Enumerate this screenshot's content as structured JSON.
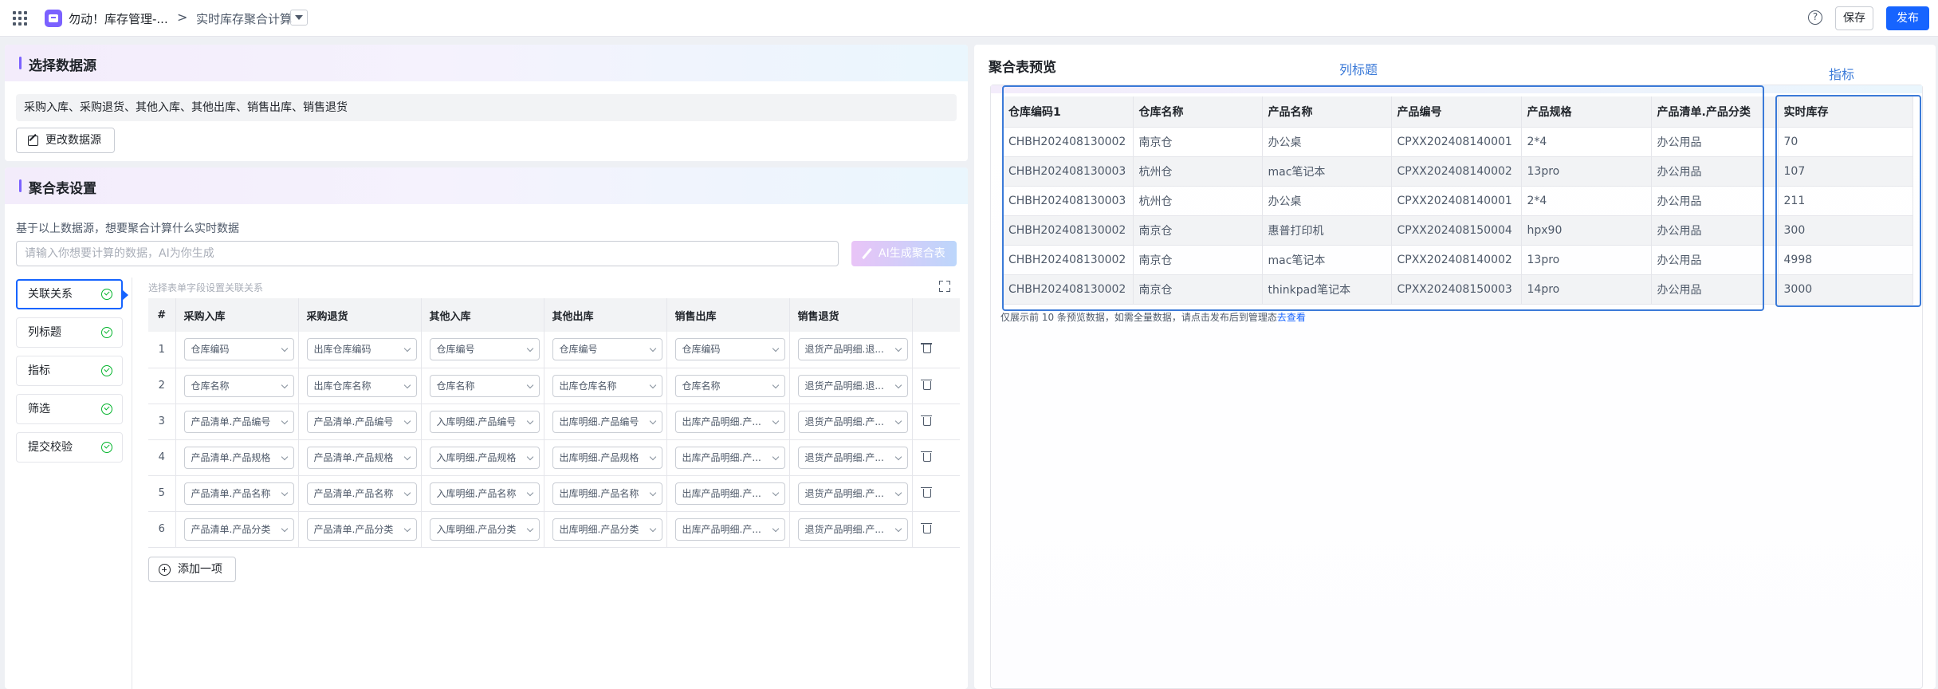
{
  "topbar": {
    "app_name": "勿动！库存管理-...",
    "breadcrumb_sep": ">",
    "page_name": "实时库存聚合计算",
    "help": "?",
    "save_label": "保存",
    "publish_label": "发布"
  },
  "datasource": {
    "title": "选择数据源",
    "value": "采购入库、采购退货、其他入库、其他出库、销售出库、销售退货",
    "change_label": "更改数据源"
  },
  "aggregation": {
    "title": "聚合表设置",
    "prompt_label": "基于以上数据源，想要聚合计算什么实时数据",
    "prompt_placeholder": "请输入你想要计算的数据，AI为你生成",
    "ai_button": "AI生成聚合表",
    "steps": [
      {
        "label": "关联关系"
      },
      {
        "label": "列标题"
      },
      {
        "label": "指标"
      },
      {
        "label": "筛选"
      },
      {
        "label": "提交校验"
      }
    ],
    "table_hint": "选择表单字段设置关联关系",
    "columns": [
      "#",
      "采购入库",
      "采购退货",
      "其他入库",
      "其他出库",
      "销售出库",
      "销售退货"
    ],
    "rows": [
      {
        "idx": "1",
        "cells": [
          "仓库编码",
          "出库仓库编码",
          "仓库编号",
          "仓库编号",
          "仓库编码",
          "退货产品明细.退..."
        ]
      },
      {
        "idx": "2",
        "cells": [
          "仓库名称",
          "出库仓库名称",
          "仓库名称",
          "出库仓库名称",
          "仓库名称",
          "退货产品明细.退..."
        ]
      },
      {
        "idx": "3",
        "cells": [
          "产品清单.产品编号",
          "产品清单.产品编号",
          "入库明细.产品编号",
          "出库明细.产品编号",
          "出库产品明细.产...",
          "退货产品明细.产..."
        ]
      },
      {
        "idx": "4",
        "cells": [
          "产品清单.产品规格",
          "产品清单.产品规格",
          "入库明细.产品规格",
          "出库明细.产品规格",
          "出库产品明细.产...",
          "退货产品明细.产..."
        ]
      },
      {
        "idx": "5",
        "cells": [
          "产品清单.产品名称",
          "产品清单.产品名称",
          "入库明细.产品名称",
          "出库明细.产品名称",
          "出库产品明细.产...",
          "退货产品明细.产..."
        ]
      },
      {
        "idx": "6",
        "cells": [
          "产品清单.产品分类",
          "产品清单.产品分类",
          "入库明细.产品分类",
          "出库明细.产品分类",
          "出库产品明细.产...",
          "退货产品明细.产..."
        ]
      }
    ],
    "add_label": "添加一项"
  },
  "preview": {
    "title": "聚合表预览",
    "columns": [
      "仓库编码1",
      "仓库名称",
      "产品名称",
      "产品编号",
      "产品规格",
      "产品清单.产品分类",
      "实时库存"
    ],
    "rows": [
      [
        "CHBH202408130002",
        "南京仓",
        "办公桌",
        "CPXX202408140001",
        "2*4",
        "办公用品",
        "70"
      ],
      [
        "CHBH202408130003",
        "杭州仓",
        "mac笔记本",
        "CPXX202408140002",
        "13pro",
        "办公用品",
        "107"
      ],
      [
        "CHBH202408130003",
        "杭州仓",
        "办公桌",
        "CPXX202408140001",
        "2*4",
        "办公用品",
        "211"
      ],
      [
        "CHBH202408130002",
        "南京仓",
        "惠普打印机",
        "CPXX202408150004",
        "hpx90",
        "办公用品",
        "300"
      ],
      [
        "CHBH202408130002",
        "南京仓",
        "mac笔记本",
        "CPXX202408140002",
        "13pro",
        "办公用品",
        "4998"
      ],
      [
        "CHBH202408130002",
        "南京仓",
        "thinkpad笔记本",
        "CPXX202408150003",
        "14pro",
        "办公用品",
        "3000"
      ]
    ],
    "note_text": "仅展示前 10 条预览数据，如需全量数据，请点击发布后到管理态",
    "note_link": "去查看"
  },
  "annotations": {
    "columns_label": "列标题",
    "metric_label": "指标",
    "color": "#3b7ad8"
  },
  "colors": {
    "primary": "#1664ff",
    "success": "#00b42a",
    "accent": "#7b61ff"
  }
}
